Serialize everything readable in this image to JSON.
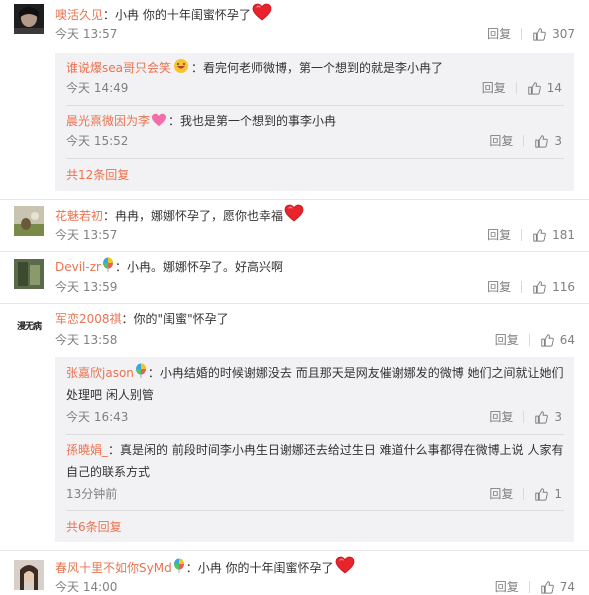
{
  "comments": [
    {
      "user": "噢活久见",
      "text": "：小冉 你的十年闺蜜怀孕了",
      "time": "今天 13:57",
      "reply": "回复",
      "likes": "307",
      "replies": [
        {
          "user": "谁说爆sea哥只会笑",
          "text": "：看完何老师微博，第一个想到的就是李小冉了",
          "time": "今天 14:49",
          "reply": "回复",
          "likes": "14"
        },
        {
          "user": "晨光熹微因为李",
          "text": "：我也是第一个想到的事李小冉",
          "time": "今天 15:52",
          "reply": "回复",
          "likes": "3"
        }
      ],
      "more": "共12条回复"
    },
    {
      "user": "花魅若初",
      "text": "：冉冉，娜娜怀孕了，愿你也幸福",
      "time": "今天 13:57",
      "reply": "回复",
      "likes": "181"
    },
    {
      "user": "Devil-zr",
      "text": "：小冉。娜娜怀孕了。好高兴啊",
      "time": "今天 13:59",
      "reply": "回复",
      "likes": "116"
    },
    {
      "user": "军恋2008祺",
      "text": "：你的\"闺蜜\"怀孕了",
      "time": "今天 13:58",
      "reply": "回复",
      "likes": "64",
      "avatar_text": "漫无病",
      "replies": [
        {
          "user": "张嘉欣jason",
          "text": "：小冉结婚的时候谢娜没去 而且那天是网友催谢娜发的微博 她们之间就让她们处理吧 闲人别管",
          "time": "今天 16:43",
          "reply": "回复",
          "likes": "3"
        },
        {
          "user": "孫曉娟_",
          "text": "：真是闲的 前段时间李小冉生日谢娜还去给过生日 难道什么事都得在微博上说 人家有自己的联系方式",
          "time": "13分钟前",
          "reply": "回复",
          "likes": "1"
        }
      ],
      "more": "共6条回复"
    },
    {
      "user": "春风十里不如你SyMd",
      "text": "：小冉 你的十年闺蜜怀孕了",
      "time": "今天 14:00",
      "reply": "回复",
      "likes": "74"
    }
  ],
  "colors": {
    "link": "#eb7350",
    "meta": "#808080",
    "subbg": "#f2f2f5",
    "heart": "#e8232b"
  }
}
